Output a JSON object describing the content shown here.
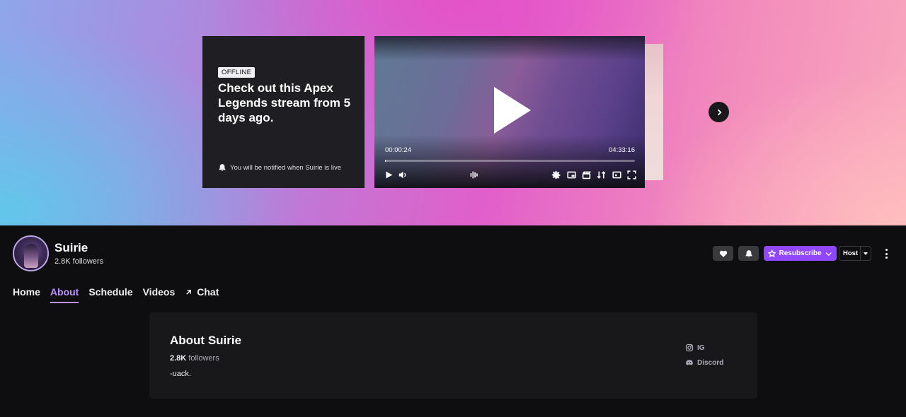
{
  "banner": {
    "offline_badge": "OFFLINE",
    "offline_title": "Check out this Apex Legends stream from 5 days ago.",
    "notify_text": "You will be notified when Suirie is live",
    "player": {
      "time_current": "00:00:24",
      "time_total": "04:33:16",
      "progress_fraction": 0.0015
    }
  },
  "channel": {
    "name": "Suirie",
    "followers": "2.8K followers"
  },
  "actions": {
    "resubscribe_label": "Resubscribe",
    "host_label": "Host"
  },
  "tabs": [
    {
      "label": "Home"
    },
    {
      "label": "About",
      "active": true
    },
    {
      "label": "Schedule"
    },
    {
      "label": "Videos"
    },
    {
      "label": "Chat"
    }
  ],
  "about": {
    "title": "About Suirie",
    "followers_count": "2.8K",
    "followers_word": "followers",
    "bio": "-uack.",
    "links": [
      {
        "label": "IG",
        "icon": "instagram-icon"
      },
      {
        "label": "Discord",
        "icon": "discord-icon"
      }
    ]
  },
  "colors": {
    "accent": "#9147ff",
    "active_tab": "#bf94ff",
    "background": "#0e0e10",
    "panel": "#18181b"
  }
}
